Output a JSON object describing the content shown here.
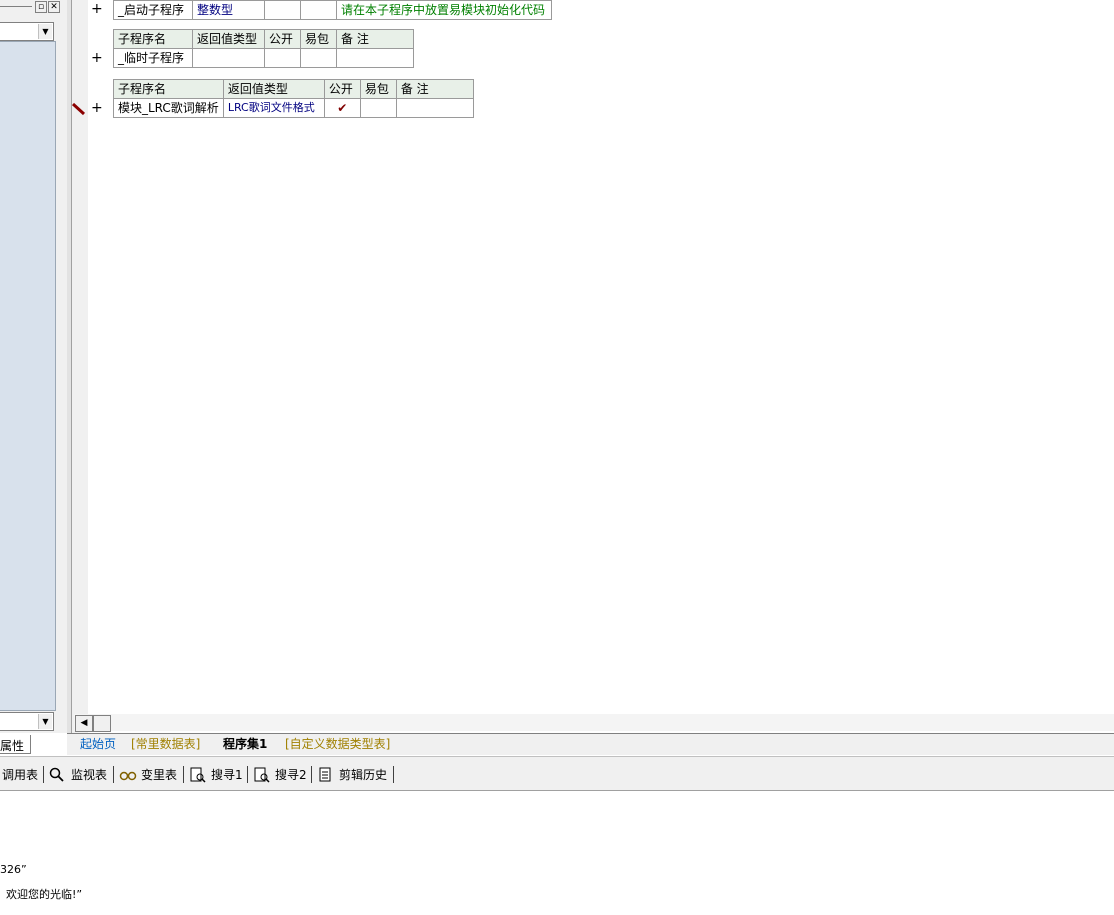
{
  "toolbar": {
    "items": [
      "调用表",
      "监视表",
      "变里表",
      "搜寻1",
      "搜寻2",
      "剪辑历史"
    ]
  },
  "tabs": {
    "left": "属性",
    "items": [
      "起始页",
      "[常里数据表]",
      "程序集1",
      "[自定义数据类型表]"
    ]
  },
  "tables": {
    "startup_row": {
      "name": "_启动子程序",
      "ret": "整数型",
      "note": "请在本子程序中放置易模块初始化代码"
    },
    "temp": {
      "headers": [
        "子程序名",
        "返回值类型",
        "公开",
        "易包",
        "备 注"
      ],
      "name": "_临时子程序"
    },
    "lrc": {
      "headers": [
        "子程序名",
        "返回值类型",
        "公开",
        "易包",
        "备 注"
      ],
      "name": "模块_LRC歌词解析",
      "ret": "LRC歌词文件格式",
      "public": "✔"
    }
  },
  "output": {
    "line1": "326”",
    "line2": "欢迎您的光临!”"
  },
  "colors": {
    "header_bg": "#e8f0e8",
    "left_list_bg": "#d8e1ec",
    "type_text": "#000080",
    "note_text": "#008000",
    "tab_active_text": "#000000",
    "tab_start_text": "#0060c0",
    "tab_other_text": "#a08000"
  },
  "icons": [
    "plus-icon",
    "pen-icon",
    "search-icon",
    "watch-icon",
    "doc-icon",
    "check-icon"
  ]
}
